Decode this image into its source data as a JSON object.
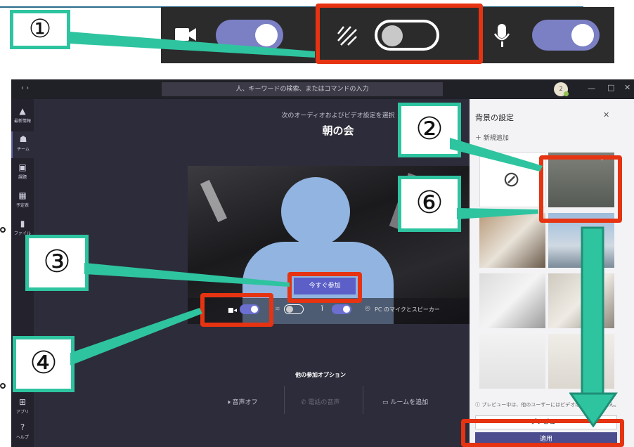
{
  "callouts": {
    "n1": "①",
    "n2": "②",
    "n3": "③",
    "n4": "④",
    "n6": "⑥"
  },
  "search": {
    "placeholder": "人、キーワードの検索、またはコマンドの入力"
  },
  "avatar": {
    "badge": "2"
  },
  "rail": {
    "items": [
      {
        "label": "最新情報",
        "icon": "bell-icon"
      },
      {
        "label": "チーム",
        "icon": "teams-icon"
      },
      {
        "label": "課題",
        "icon": "assignment-icon"
      },
      {
        "label": "予定表",
        "icon": "calendar-icon"
      },
      {
        "label": "ファイル",
        "icon": "file-icon"
      }
    ],
    "bottom": [
      {
        "label": "アプリ",
        "icon": "apps-icon"
      },
      {
        "label": "ヘルプ",
        "icon": "help-icon"
      }
    ]
  },
  "meeting": {
    "subtitle": "次のオーディオおよびビデオ設定を選択",
    "title": "朝の会",
    "join_label": "今すぐ参加",
    "audio_label": "PC のマイクとスピーカー",
    "other_options_title": "他の参加オプション",
    "option_audio_off": "音声オフ",
    "option_phone": "電話の音声",
    "option_room": "ルームを追加"
  },
  "background_panel": {
    "title": "背景の設定",
    "add_new": "新規追加",
    "notice": "プレビュー中は、他のユーザーにはビデオは表示されません。",
    "preview_label": "プレビュー",
    "apply_label": "適用"
  },
  "colors": {
    "accent": "#6264a7",
    "callout_border": "#2ec4a0",
    "highlight_red": "#e63312",
    "app_bg": "#2d2c3a"
  }
}
